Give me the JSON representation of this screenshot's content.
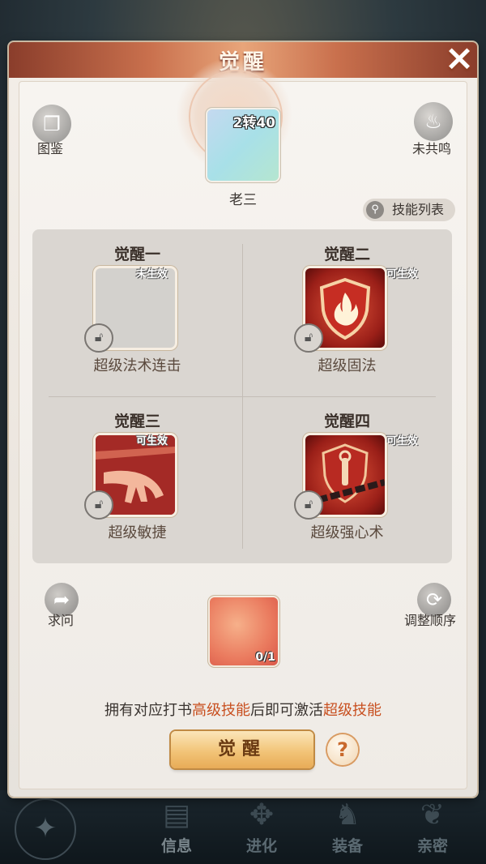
{
  "dialog": {
    "title": "觉醒",
    "close_icon": "×"
  },
  "top": {
    "codex_label": "图鉴",
    "resonance_label": "未共鸣",
    "pet": {
      "level": "2转40",
      "name": "老三"
    },
    "skill_list_label": "技能列表"
  },
  "slots": [
    {
      "title": "觉醒一",
      "status": "未生效",
      "skill": "超级法术连击"
    },
    {
      "title": "觉醒二",
      "status": "可生效",
      "skill": "超级固法"
    },
    {
      "title": "觉醒三",
      "status": "可生效",
      "skill": "超级敏捷"
    },
    {
      "title": "觉醒四",
      "status": "可生效",
      "skill": "超级强心术"
    }
  ],
  "bottom": {
    "ask_label": "求问",
    "reorder_label": "调整顺序",
    "material_count": "0/1",
    "hint_pre": "拥有对应打书",
    "hint_hl1": "高级技能",
    "hint_mid": "后即可激活",
    "hint_hl2": "超级技能",
    "awaken_label": "觉醒",
    "help_icon": "?"
  },
  "nav": {
    "info": "信息",
    "evolve": "进化",
    "equip": "装备",
    "intimacy": "亲密"
  },
  "colors": {
    "highlight": "#c84f1f",
    "title_bar": "#c9704d",
    "button": "#f2c478"
  }
}
